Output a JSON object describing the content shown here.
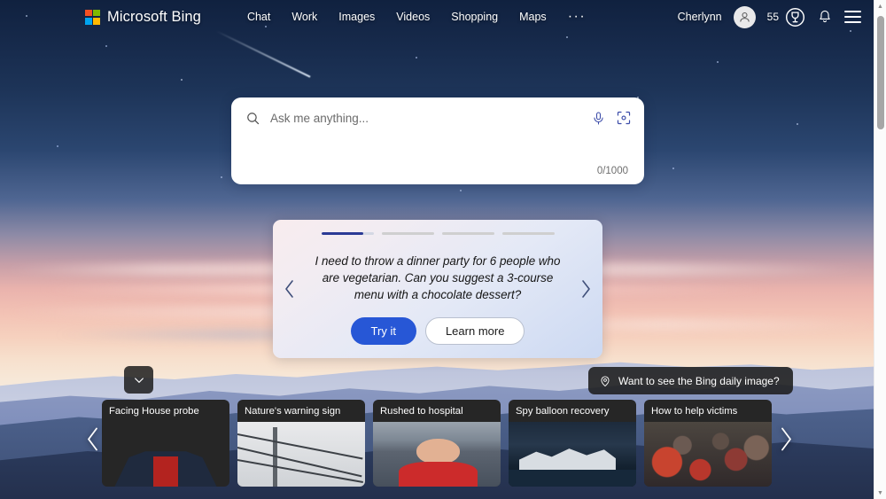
{
  "header": {
    "logo_text": "Microsoft Bing",
    "logo_colors": [
      "#f25022",
      "#7fba00",
      "#00a4ef",
      "#ffb900"
    ],
    "nav": [
      {
        "label": "Chat",
        "name": "nav-chat"
      },
      {
        "label": "Work",
        "name": "nav-work"
      },
      {
        "label": "Images",
        "name": "nav-images"
      },
      {
        "label": "Videos",
        "name": "nav-videos"
      },
      {
        "label": "Shopping",
        "name": "nav-shopping"
      },
      {
        "label": "Maps",
        "name": "nav-maps"
      }
    ],
    "more_label": "···",
    "user_name": "Cherlynn",
    "rewards_points": "55"
  },
  "search": {
    "placeholder": "Ask me anything...",
    "value": "",
    "counter": "0/1000"
  },
  "suggestion": {
    "slide_count": 4,
    "active_slide": 1,
    "text": "I need to throw a dinner party for 6 people who are vegetarian. Can you suggest a 3-course menu with a chocolate dessert?",
    "primary_label": "Try it",
    "secondary_label": "Learn more",
    "prev_glyph": "‹",
    "next_glyph": "›",
    "accent_color": "#2757d6",
    "progress_color": "#2b3a95"
  },
  "daily_image": {
    "label": "Want to see the Bing daily image?"
  },
  "feed": {
    "expand_glyph": "⌄",
    "prev_glyph": "‹",
    "next_glyph": "›",
    "cards": [
      {
        "title": "Facing House probe"
      },
      {
        "title": "Nature's warning sign"
      },
      {
        "title": "Rushed to hospital"
      },
      {
        "title": "Spy balloon recovery"
      },
      {
        "title": "How to help victims"
      }
    ]
  },
  "scrollbar": {
    "up_glyph": "▲",
    "down_glyph": "▼"
  }
}
